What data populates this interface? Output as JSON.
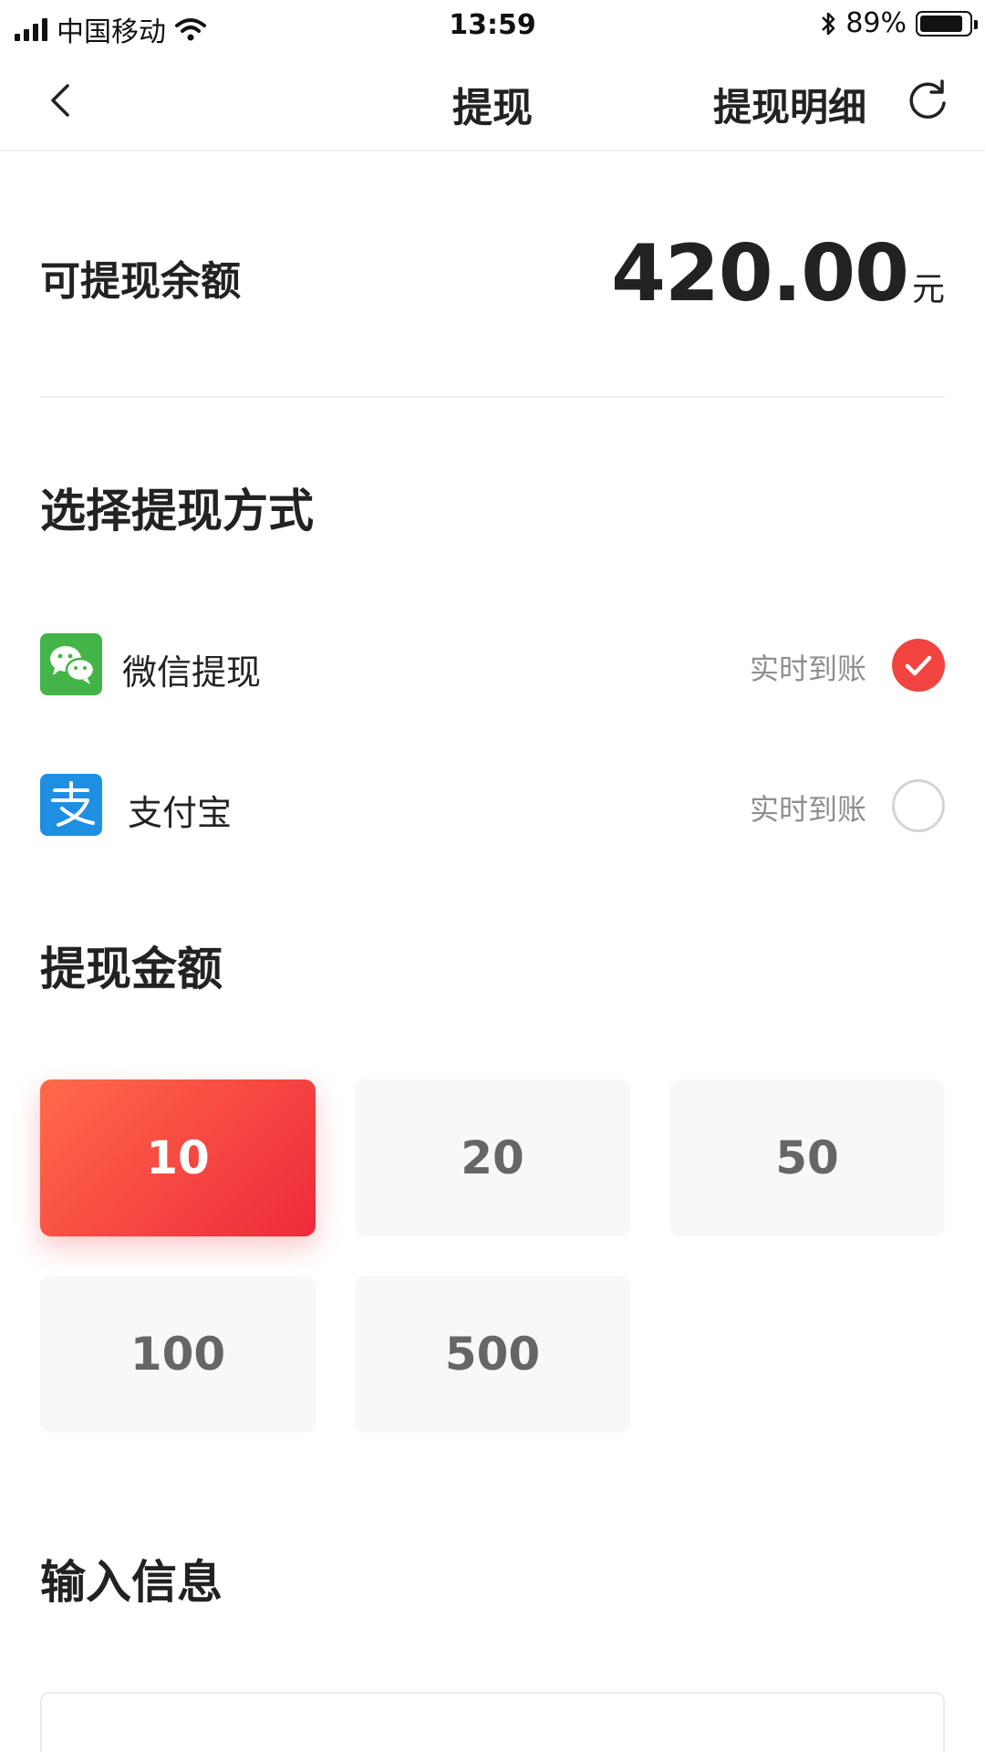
{
  "status_bar": {
    "carrier": "中国移动",
    "time": "13:59",
    "battery": "89%",
    "battery_level": 0.89
  },
  "nav": {
    "title": "提现",
    "detail_label": "提现明细",
    "back_icon": "chevron-left-icon",
    "refresh_icon": "refresh-icon"
  },
  "balance": {
    "label": "可提现余额",
    "amount": "420.00",
    "unit": "元"
  },
  "method_section": {
    "title": "选择提现方式",
    "methods": [
      {
        "label": "微信提现",
        "note": "实时到账",
        "icon": "wechat-icon",
        "selected": true
      },
      {
        "label": "支付宝",
        "note": "实时到账",
        "icon": "alipay-icon",
        "selected": false
      }
    ]
  },
  "amount_section": {
    "title": "提现金额",
    "options": [
      "10",
      "20",
      "50",
      "100",
      "500"
    ],
    "selected": "10"
  },
  "info_section": {
    "title": "输入信息"
  },
  "colors": {
    "accent": "#f1433f",
    "wechat": "#43b548",
    "alipay": "#1f8fe2"
  }
}
